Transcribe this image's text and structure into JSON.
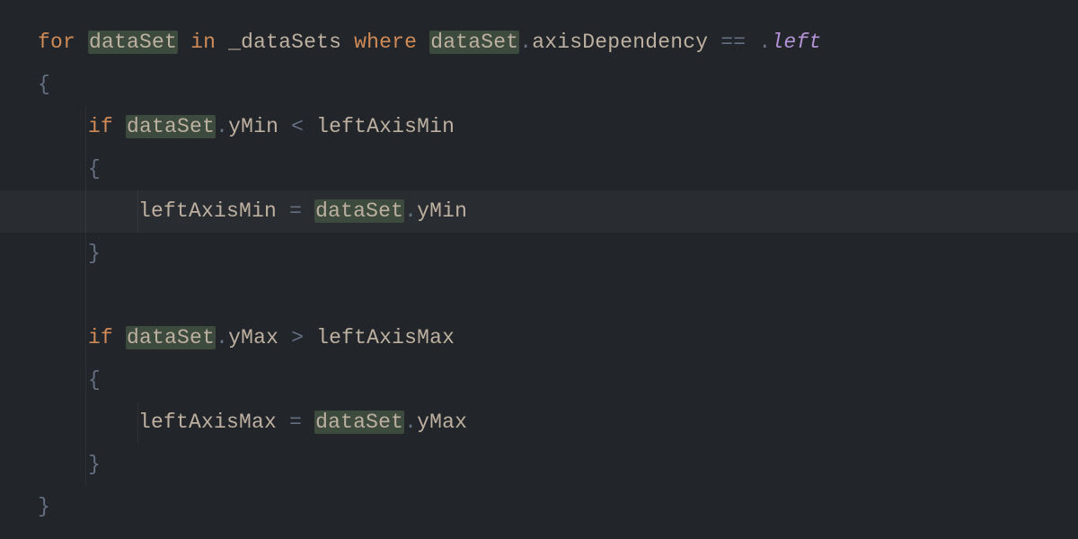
{
  "colors": {
    "background": "#22252a",
    "keyword": "#cf8a56",
    "identifier": "#bdb0a0",
    "punct": "#657082",
    "enum": "#b392d6",
    "highlightBg": "#3c4b3d"
  },
  "code": {
    "highlightedIdentifier": "dataSet",
    "lines": [
      {
        "indent": 0,
        "highlighted": false,
        "tokens": [
          {
            "t": "for",
            "c": "kw-for"
          },
          {
            "t": " "
          },
          {
            "t": "dataSet",
            "c": "var-hl"
          },
          {
            "t": " "
          },
          {
            "t": "in",
            "c": "kw-for"
          },
          {
            "t": " "
          },
          {
            "t": "_dataSets",
            "c": "ident"
          },
          {
            "t": " "
          },
          {
            "t": "where",
            "c": "kw-for"
          },
          {
            "t": " "
          },
          {
            "t": "dataSet",
            "c": "var-hl"
          },
          {
            "t": ".",
            "c": "punct"
          },
          {
            "t": "axisDependency",
            "c": "prop"
          },
          {
            "t": " "
          },
          {
            "t": "==",
            "c": "op"
          },
          {
            "t": " "
          },
          {
            "t": ".",
            "c": "punct"
          },
          {
            "t": "left",
            "c": "enum"
          }
        ]
      },
      {
        "indent": 0,
        "highlighted": false,
        "tokens": [
          {
            "t": "{",
            "c": "punct"
          }
        ]
      },
      {
        "indent": 1,
        "highlighted": false,
        "tokens": [
          {
            "t": "if",
            "c": "kw-if"
          },
          {
            "t": " "
          },
          {
            "t": "dataSet",
            "c": "var-hl"
          },
          {
            "t": ".",
            "c": "punct"
          },
          {
            "t": "yMin",
            "c": "prop"
          },
          {
            "t": " "
          },
          {
            "t": "<",
            "c": "op"
          },
          {
            "t": " "
          },
          {
            "t": "leftAxisMin",
            "c": "ident"
          }
        ]
      },
      {
        "indent": 1,
        "highlighted": false,
        "tokens": [
          {
            "t": "{",
            "c": "punct"
          }
        ]
      },
      {
        "indent": 2,
        "highlighted": true,
        "tokens": [
          {
            "t": "leftAxisMin",
            "c": "ident"
          },
          {
            "t": " "
          },
          {
            "t": "=",
            "c": "op"
          },
          {
            "t": " "
          },
          {
            "t": "dataSet",
            "c": "var-hl"
          },
          {
            "t": ".",
            "c": "punct"
          },
          {
            "t": "yMin",
            "c": "prop"
          }
        ]
      },
      {
        "indent": 1,
        "highlighted": false,
        "tokens": [
          {
            "t": "}",
            "c": "punct"
          }
        ]
      },
      {
        "indent": 1,
        "highlighted": false,
        "tokens": []
      },
      {
        "indent": 1,
        "highlighted": false,
        "tokens": [
          {
            "t": "if",
            "c": "kw-if"
          },
          {
            "t": " "
          },
          {
            "t": "dataSet",
            "c": "var-hl"
          },
          {
            "t": ".",
            "c": "punct"
          },
          {
            "t": "yMax",
            "c": "prop"
          },
          {
            "t": " "
          },
          {
            "t": ">",
            "c": "op"
          },
          {
            "t": " "
          },
          {
            "t": "leftAxisMax",
            "c": "ident"
          }
        ]
      },
      {
        "indent": 1,
        "highlighted": false,
        "tokens": [
          {
            "t": "{",
            "c": "punct"
          }
        ]
      },
      {
        "indent": 2,
        "highlighted": false,
        "tokens": [
          {
            "t": "leftAxisMax",
            "c": "ident"
          },
          {
            "t": " "
          },
          {
            "t": "=",
            "c": "op"
          },
          {
            "t": " "
          },
          {
            "t": "dataSet",
            "c": "var-hl"
          },
          {
            "t": ".",
            "c": "punct"
          },
          {
            "t": "yMax",
            "c": "prop"
          }
        ]
      },
      {
        "indent": 1,
        "highlighted": false,
        "tokens": [
          {
            "t": "}",
            "c": "punct"
          }
        ]
      },
      {
        "indent": 0,
        "highlighted": false,
        "tokens": [
          {
            "t": "}",
            "c": "punct"
          }
        ]
      }
    ]
  }
}
